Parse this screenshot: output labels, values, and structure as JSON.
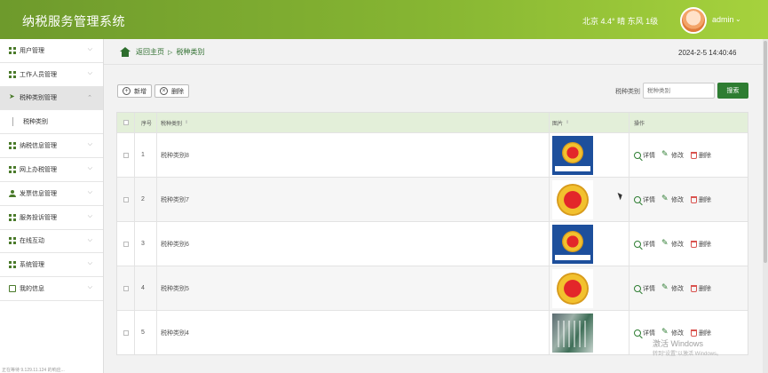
{
  "header": {
    "title": "纳税服务管理系统",
    "weather": "北京 4.4° 晴 东风 1级",
    "user": "admin"
  },
  "sidebar": {
    "items": [
      {
        "label": "用户管理",
        "icon": "grid-icon"
      },
      {
        "label": "工作人员管理",
        "icon": "grid-icon"
      },
      {
        "label": "税种类别管理",
        "icon": "plane-icon",
        "active": true
      },
      {
        "label": "纳税信息管理",
        "icon": "grid-icon"
      },
      {
        "label": "网上办税管理",
        "icon": "grid-icon"
      },
      {
        "label": "发票信息管理",
        "icon": "user-icon"
      },
      {
        "label": "服务投诉管理",
        "icon": "grid-icon"
      },
      {
        "label": "在线互动",
        "icon": "grid-icon"
      },
      {
        "label": "系统管理",
        "icon": "grid-icon"
      },
      {
        "label": "我的信息",
        "icon": "card-icon"
      }
    ],
    "submenu": "税种类别",
    "footer": "正在等待 9.129.11.124 的响应..."
  },
  "breadcrumb": {
    "home": "返回主页",
    "separator": "▷",
    "current": "税种类别"
  },
  "datetime": "2024-2-5 14:40:46",
  "toolbar": {
    "add": "新增",
    "delete": "删除"
  },
  "search": {
    "label": "税种类别",
    "placeholder": "税种类别",
    "button": "搜索"
  },
  "table": {
    "headers": {
      "index": "序号",
      "name": "税种类别",
      "image": "图片",
      "ops": "操作"
    },
    "rows": [
      {
        "index": "1",
        "name": "税种类别8",
        "thumb": "blue-emblem"
      },
      {
        "index": "2",
        "name": "税种类别7",
        "thumb": "white-emblem"
      },
      {
        "index": "3",
        "name": "税种类别6",
        "thumb": "blue-emblem"
      },
      {
        "index": "4",
        "name": "税种类别5",
        "thumb": "white-emblem"
      },
      {
        "index": "5",
        "name": "税种类别4",
        "thumb": "photo"
      }
    ],
    "ops": {
      "detail": "详情",
      "edit": "修改",
      "delete": "删除"
    }
  },
  "overlay": {
    "activate": "激活 Windows",
    "activate_sub": "转到“设置”以激活 Windows。"
  }
}
